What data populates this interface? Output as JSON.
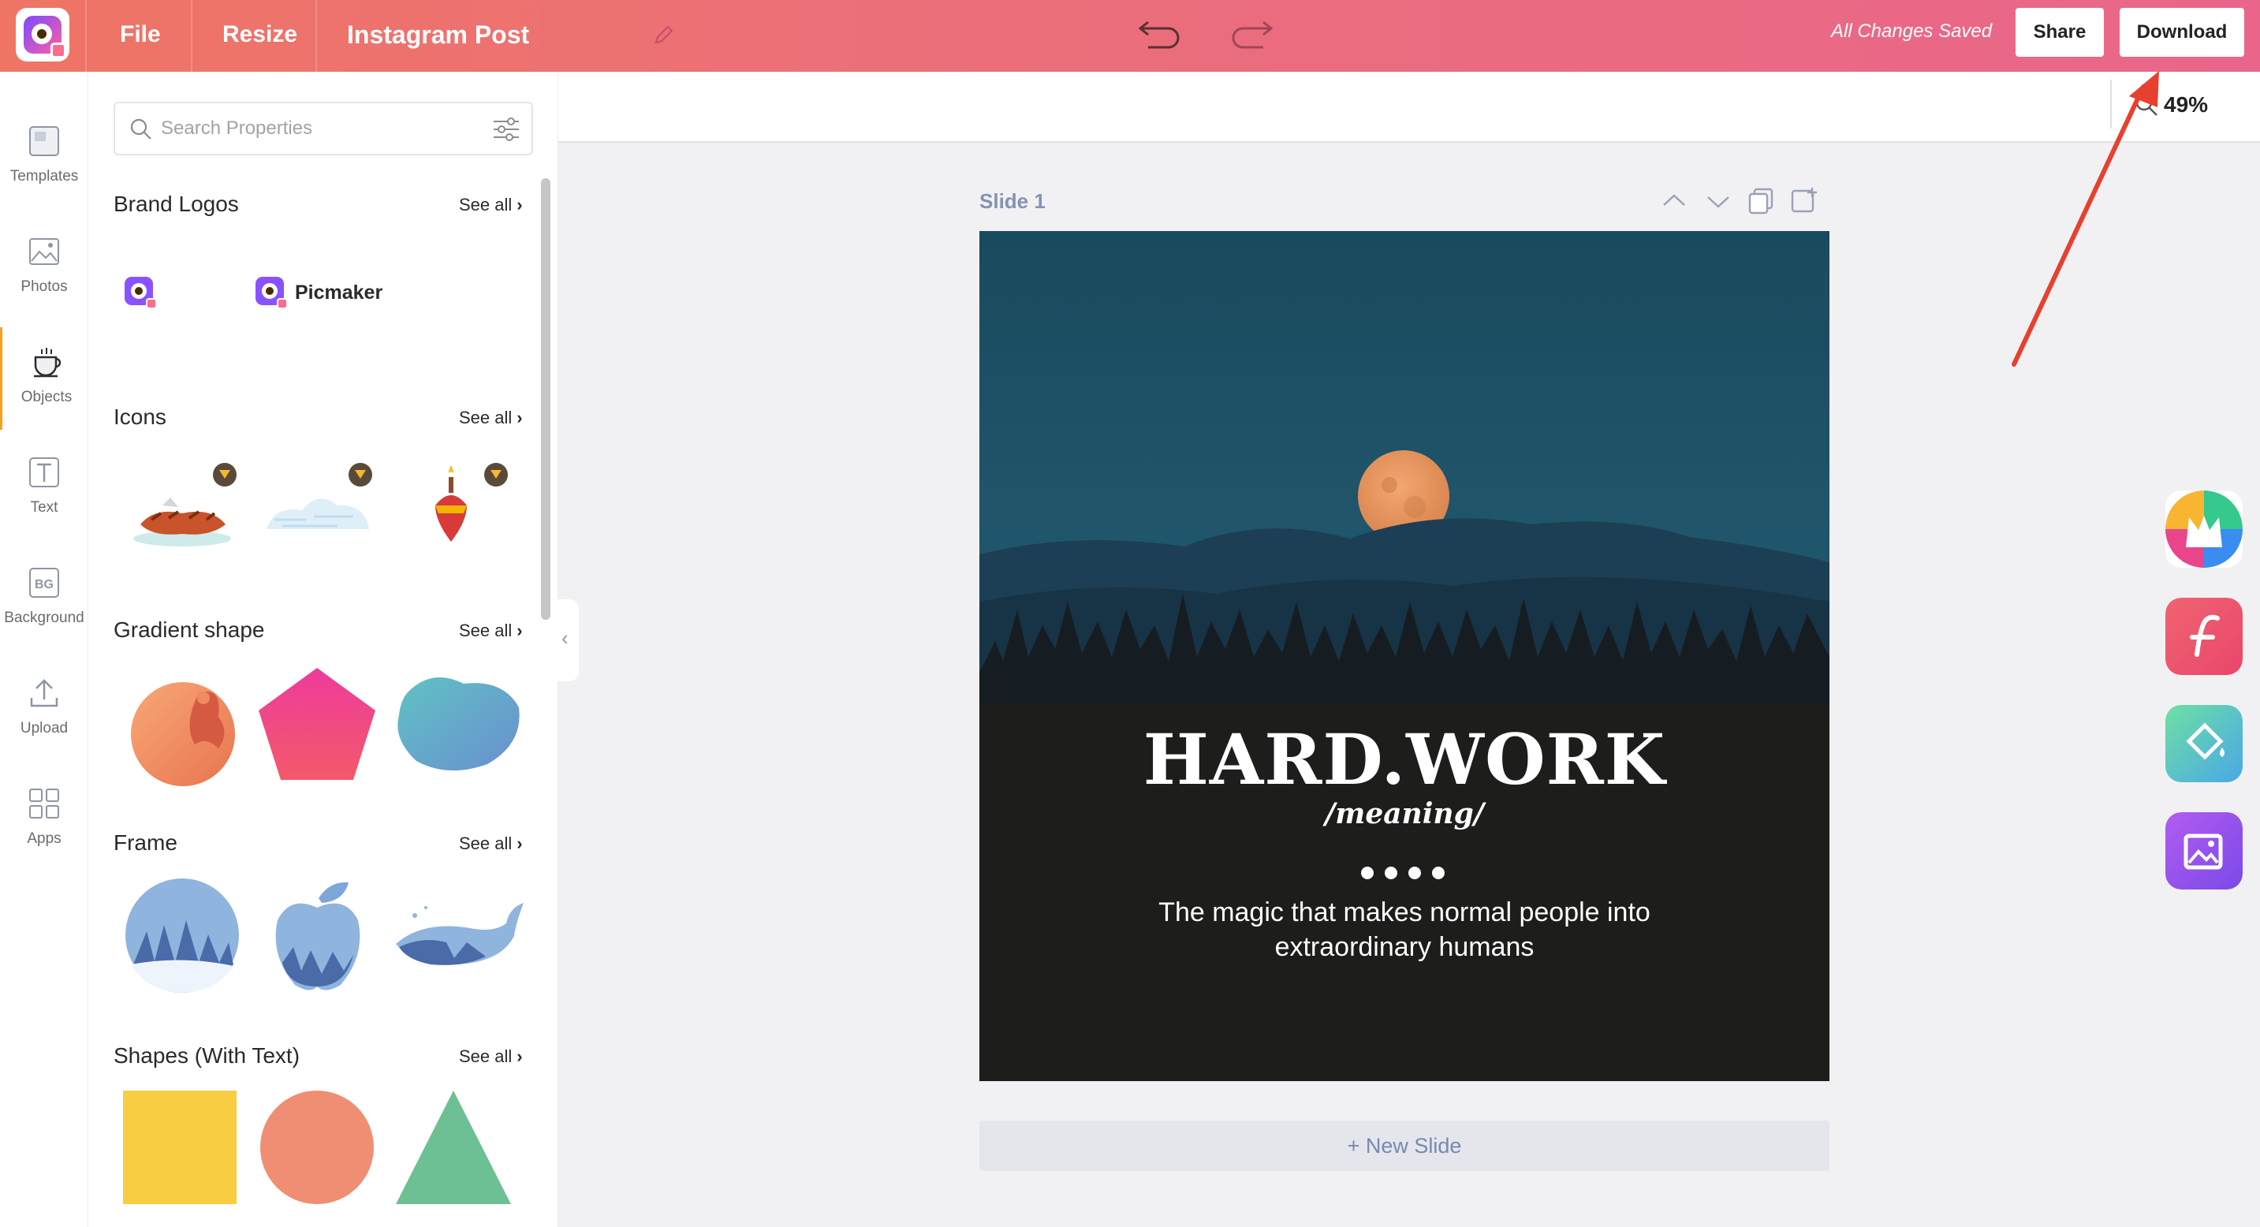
{
  "topbar": {
    "file_label": "File",
    "resize_label": "Resize",
    "doc_title": "Instagram Post",
    "status": "All Changes Saved",
    "share_label": "Share",
    "download_label": "Download"
  },
  "rail": {
    "items": [
      {
        "label": "Templates",
        "icon": "templates-icon"
      },
      {
        "label": "Photos",
        "icon": "photos-icon"
      },
      {
        "label": "Objects",
        "icon": "objects-icon",
        "active": true
      },
      {
        "label": "Text",
        "icon": "text-icon"
      },
      {
        "label": "Background",
        "icon": "background-icon"
      },
      {
        "label": "Upload",
        "icon": "upload-icon"
      },
      {
        "label": "Apps",
        "icon": "apps-icon"
      }
    ],
    "active_color": "#f7a01d"
  },
  "panel": {
    "search_placeholder": "Search Properties",
    "sections": [
      {
        "title": "Brand Logos",
        "see_all": "See all"
      },
      {
        "title": "Icons",
        "see_all": "See all"
      },
      {
        "title": "Gradient shape",
        "see_all": "See all"
      },
      {
        "title": "Frame",
        "see_all": "See all"
      },
      {
        "title": "Shapes (With Text)",
        "see_all": "See all"
      }
    ],
    "brand_logo_text": "Picmaker"
  },
  "canvas": {
    "zoom": "49%",
    "slide_label": "Slide 1",
    "headline": "HARD.WORK",
    "subheadline": "/meaning/",
    "tagline": "The magic that makes normal people into extraordinary humans",
    "new_slide_label": "+ New Slide"
  },
  "colors": {
    "topbar_start": "#ef7565",
    "topbar_end": "#e9668a",
    "annotation_arrow": "#e8402f",
    "slide_title": "#8691b5"
  }
}
